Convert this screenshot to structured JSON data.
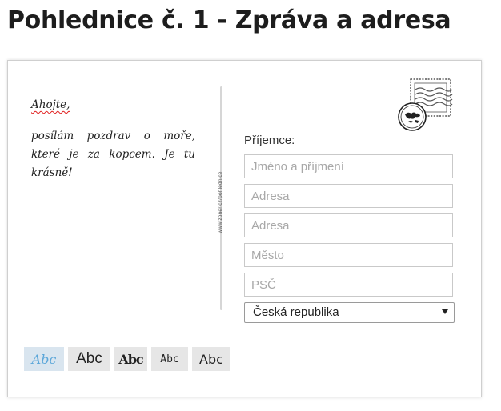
{
  "page": {
    "title": "Pohlednice č. 1 - Zpráva a adresa"
  },
  "message": {
    "greeting": "Ahojte,",
    "body": "posílám pozdrav o moře, které je za kopcem. Je tu krásně!"
  },
  "card": {
    "vertical_url": "www.zoner.cz/pohlednice"
  },
  "recipient": {
    "label": "Příjemce:",
    "name_placeholder": "Jméno a příjmení",
    "address1_placeholder": "Adresa",
    "address2_placeholder": "Adresa",
    "city_placeholder": "Město",
    "zip_placeholder": "PSČ",
    "country_selected": "Česká republika"
  },
  "font_options": [
    {
      "label": "Abc",
      "active": true
    },
    {
      "label": "Abc",
      "active": false
    },
    {
      "label": "Abc",
      "active": false
    },
    {
      "label": "Abc",
      "active": false
    },
    {
      "label": "Abc",
      "active": false
    }
  ],
  "icons": {
    "stamp": "postage-stamp-icon",
    "postmark": "postmark-globe-icon",
    "dropdown": "chevron-down-icon"
  },
  "colors": {
    "active_font": "#5aa6d9",
    "spellcheck_underline": "#e02020"
  }
}
